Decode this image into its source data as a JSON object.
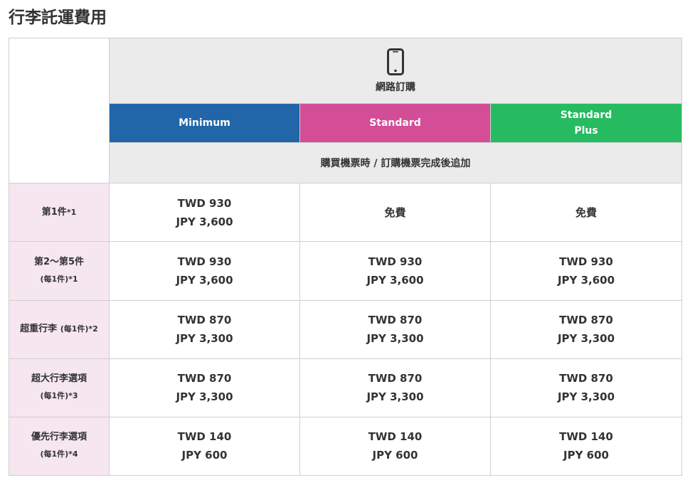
{
  "page_title": "行李託運費用",
  "channel": {
    "label": "網路訂購",
    "icon": "smartphone-icon"
  },
  "fares": [
    {
      "name": "Minimum",
      "color": "#2166a9"
    },
    {
      "name": "Standard",
      "color": "#d34e97"
    },
    {
      "name": "Standard\nPlus",
      "color": "#26bb60"
    }
  ],
  "timing_label": "購買機票時 / 訂購機票完成後追加",
  "rows": [
    {
      "label": "第1件",
      "label_sub": "",
      "note": "*1",
      "cells": [
        {
          "line1": "TWD 930",
          "line2": "JPY 3,600"
        },
        {
          "line1": "免費",
          "line2": ""
        },
        {
          "line1": "免費",
          "line2": ""
        }
      ]
    },
    {
      "label": "第2～第5件",
      "label_sub": "(每1件)",
      "note": "*1",
      "cells": [
        {
          "line1": "TWD 930",
          "line2": "JPY 3,600"
        },
        {
          "line1": "TWD 930",
          "line2": "JPY 3,600"
        },
        {
          "line1": "TWD 930",
          "line2": "JPY 3,600"
        }
      ]
    },
    {
      "label": "超重行李",
      "label_sub": "(每1件)",
      "note": "*2",
      "cells": [
        {
          "line1": "TWD 870",
          "line2": "JPY 3,300"
        },
        {
          "line1": "TWD 870",
          "line2": "JPY 3,300"
        },
        {
          "line1": "TWD 870",
          "line2": "JPY 3,300"
        }
      ]
    },
    {
      "label": "超大行李選項",
      "label_sub": "(每1件)",
      "note": "*3",
      "cells": [
        {
          "line1": "TWD 870",
          "line2": "JPY 3,300"
        },
        {
          "line1": "TWD 870",
          "line2": "JPY 3,300"
        },
        {
          "line1": "TWD 870",
          "line2": "JPY 3,300"
        }
      ]
    },
    {
      "label": "優先行李選項",
      "label_sub": "(每1件)",
      "note": "*4",
      "cells": [
        {
          "line1": "TWD 140",
          "line2": "JPY 600"
        },
        {
          "line1": "TWD 140",
          "line2": "JPY 600"
        },
        {
          "line1": "TWD 140",
          "line2": "JPY 600"
        }
      ]
    }
  ]
}
